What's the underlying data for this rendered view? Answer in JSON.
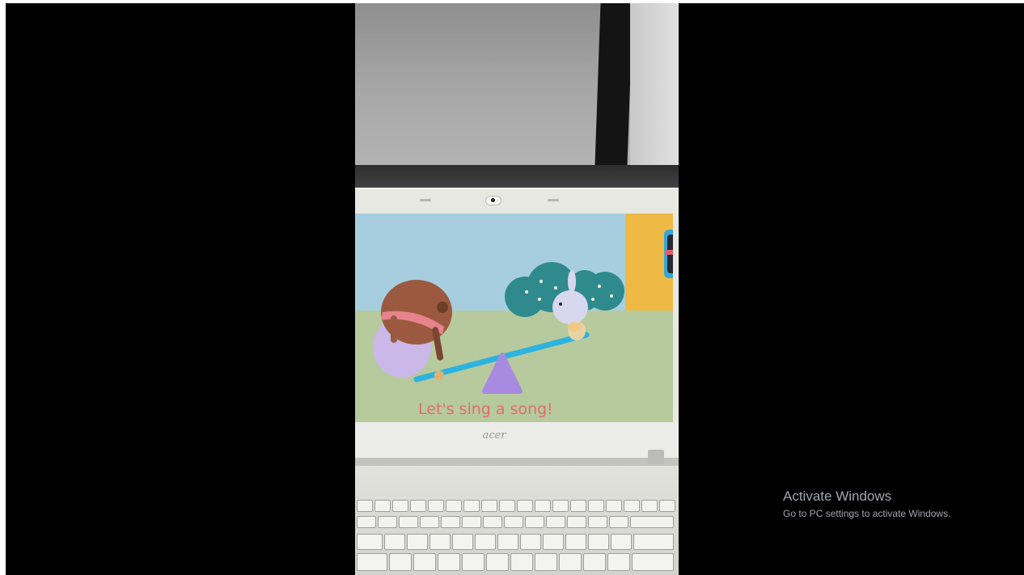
{
  "scene_caption": "Let's sing a song!",
  "laptop_brand": "acer",
  "windows_watermark": {
    "title": "Activate Windows",
    "subtitle": "Go to PC settings to activate Windows."
  },
  "colors": {
    "letterbox": "#000000",
    "sky": "#a7cedf",
    "grass": "#b7ca9d",
    "house": "#eeb945",
    "seesaw_plank": "#2cb3df",
    "seesaw_pivot": "#a88be0",
    "caption": "#e06c73"
  }
}
